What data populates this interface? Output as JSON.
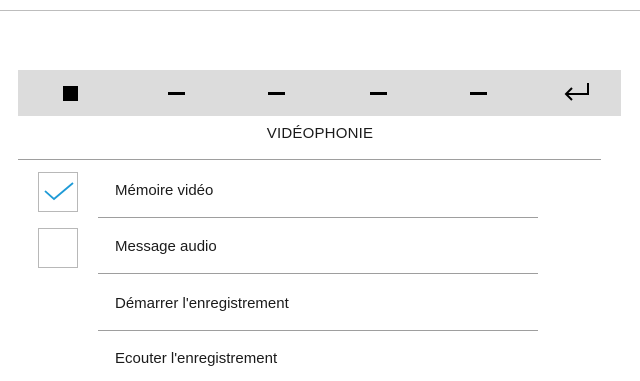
{
  "toolbar": {
    "buttons": [
      {
        "icon": "stop-icon"
      },
      {
        "icon": "dash-icon"
      },
      {
        "icon": "dash-icon"
      },
      {
        "icon": "dash-icon"
      },
      {
        "icon": "dash-icon"
      },
      {
        "icon": "enter-back-icon"
      }
    ]
  },
  "page": {
    "title": "VIDÉOPHONIE"
  },
  "items": [
    {
      "label": "Mémoire vidéo",
      "checked": true
    },
    {
      "label": "Message audio",
      "checked": false
    },
    {
      "label": "Démarrer l'enregistrement"
    },
    {
      "label": "Ecouter l'enregistrement"
    }
  ],
  "colors": {
    "toolbar_bg": "#dcdcdc",
    "check_accent": "#1e9ad6"
  }
}
